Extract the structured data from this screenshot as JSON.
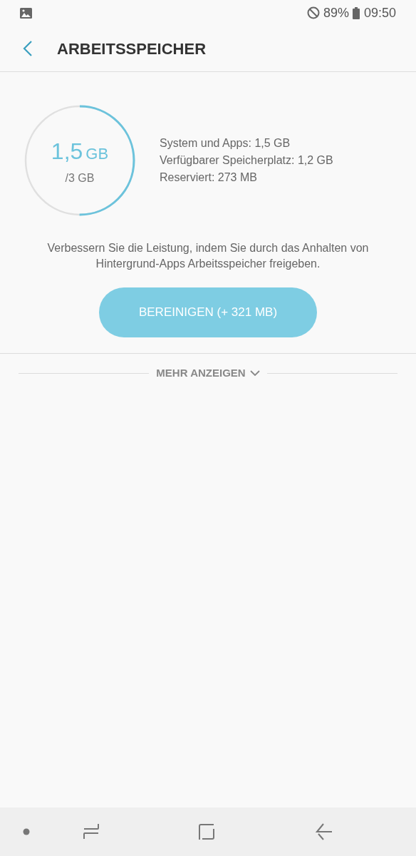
{
  "status_bar": {
    "battery": "89%",
    "time": "09:50"
  },
  "header": {
    "title": "ARBEITSSPEICHER"
  },
  "memory": {
    "level": 0.5,
    "used": "1,5",
    "used_unit": "GB",
    "total": "/3 GB",
    "details": [
      "System und Apps: 1,5 GB",
      "Verfügbarer Speicherplatz: 1,2 GB",
      "Reserviert: 273 MB"
    ]
  },
  "description": "Verbessern Sie die Leistung, indem Sie durch das Anhalten von Hintergrund-Apps Arbeitsspeicher freigeben.",
  "clean_button": "BEREINIGEN (+ 321 MB)",
  "show_more": "MEHR ANZEIGEN"
}
